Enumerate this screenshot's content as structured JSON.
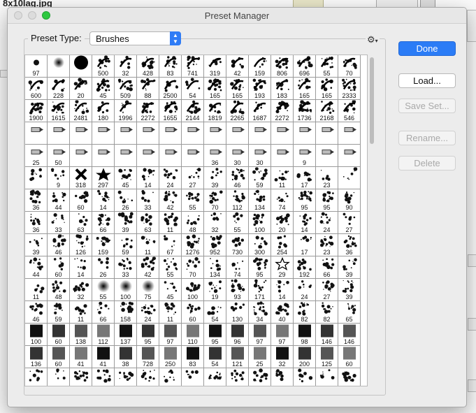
{
  "desktop": {
    "file_name": "8x10lag.jpg"
  },
  "window": {
    "title": "Preset Manager"
  },
  "preset_type": {
    "label": "Preset Type:",
    "selected": "Brushes"
  },
  "gear_icon": "gear-icon",
  "buttons": {
    "done": "Done",
    "load": "Load...",
    "save_set": "Save Set...",
    "rename": "Rename...",
    "delete": "Delete"
  },
  "brush_sizes": [
    "97",
    "",
    "",
    "500",
    "32",
    "428",
    "83",
    "741",
    "319",
    "42",
    "159",
    "806",
    "696",
    "55",
    "70",
    "600",
    "228",
    "20",
    "45",
    "509",
    "88",
    "2500",
    "54",
    "165",
    "165",
    "193",
    "183",
    "165",
    "165",
    "2333",
    "1900",
    "1615",
    "2481",
    "180",
    "1996",
    "2272",
    "1655",
    "2144",
    "1819",
    "2265",
    "1687",
    "2272",
    "1736",
    "2168",
    "546",
    "",
    "",
    "",
    "",
    "",
    "",
    "",
    "",
    "",
    "",
    "",
    "",
    "",
    "",
    "",
    "25",
    "50",
    "",
    "",
    "",
    "",
    "",
    "",
    "36",
    "30",
    "30",
    "",
    "9",
    "",
    "",
    "",
    "9",
    "318",
    "297",
    "45",
    "14",
    "24",
    "27",
    "39",
    "46",
    "59",
    "11",
    "17",
    "23",
    "",
    "36",
    "44",
    "60",
    "14",
    "26",
    "33",
    "42",
    "55",
    "70",
    "112",
    "134",
    "74",
    "95",
    "95",
    "90",
    "36",
    "33",
    "63",
    "66",
    "39",
    "63",
    "11",
    "48",
    "32",
    "55",
    "100",
    "20",
    "14",
    "24",
    "27",
    "39",
    "46",
    "126",
    "159",
    "59",
    "11",
    "67",
    "1276",
    "952",
    "730",
    "300",
    "254",
    "17",
    "23",
    "36",
    "44",
    "60",
    "14",
    "26",
    "33",
    "42",
    "55",
    "70",
    "134",
    "74",
    "95",
    "29",
    "192",
    "66",
    "39",
    "11",
    "48",
    "32",
    "55",
    "100",
    "75",
    "45",
    "100",
    "19",
    "93",
    "171",
    "14",
    "24",
    "27",
    "39",
    "46",
    "59",
    "11",
    "66",
    "158",
    "24",
    "11",
    "60",
    "54",
    "130",
    "34",
    "40",
    "82",
    "82",
    "65",
    "100",
    "60",
    "138",
    "112",
    "137",
    "95",
    "97",
    "110",
    "95",
    "96",
    "97",
    "97",
    "98",
    "146",
    "146",
    "136",
    "60",
    "41",
    "41",
    "38",
    "728",
    "250",
    "83",
    "54",
    "121",
    "25",
    "32",
    "200",
    "125",
    "60",
    "",
    "",
    "",
    "",
    "",
    "",
    "",
    "",
    "",
    "",
    "",
    "",
    "",
    "",
    ""
  ]
}
